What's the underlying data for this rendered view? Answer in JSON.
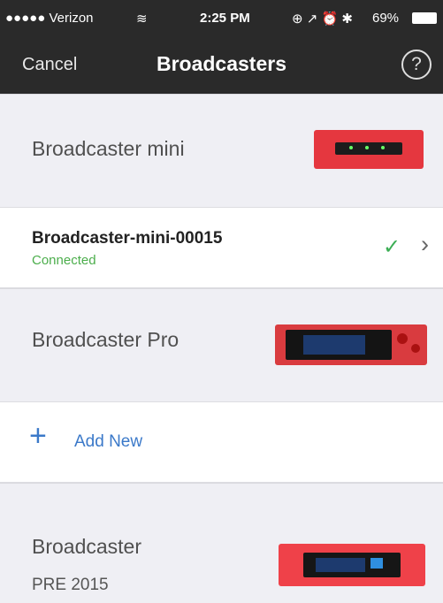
{
  "status_bar": {
    "carrier": "●●●●● Verizon",
    "wifi": "wifi-icon",
    "time": "2:25 PM",
    "indicators": "⊕ ↗ ⏰ ✱",
    "battery": "69%"
  },
  "nav": {
    "cancel_label": "Cancel",
    "title": "Broadcasters",
    "help_symbol": "?"
  },
  "sections": {
    "mini_label": "Broadcaster mini",
    "pro_label": "Broadcaster Pro",
    "pre_label": "Broadcaster",
    "pre_sub": "PRE 2015"
  },
  "device": {
    "name": "Broadcaster-mini-00015",
    "status": "Connected"
  },
  "add_new": {
    "label": "Add New"
  },
  "colors": {
    "accent": "#3b79c9",
    "connected": "#4cae4c",
    "device_red": "#e5373f"
  }
}
